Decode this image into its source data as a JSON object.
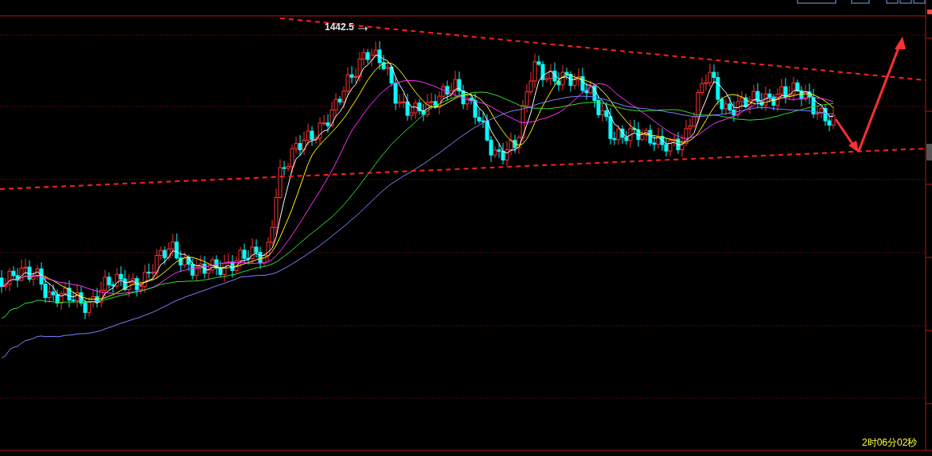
{
  "chart": {
    "high_label": "1442.5",
    "countdown": "2时06分02秒"
  }
}
